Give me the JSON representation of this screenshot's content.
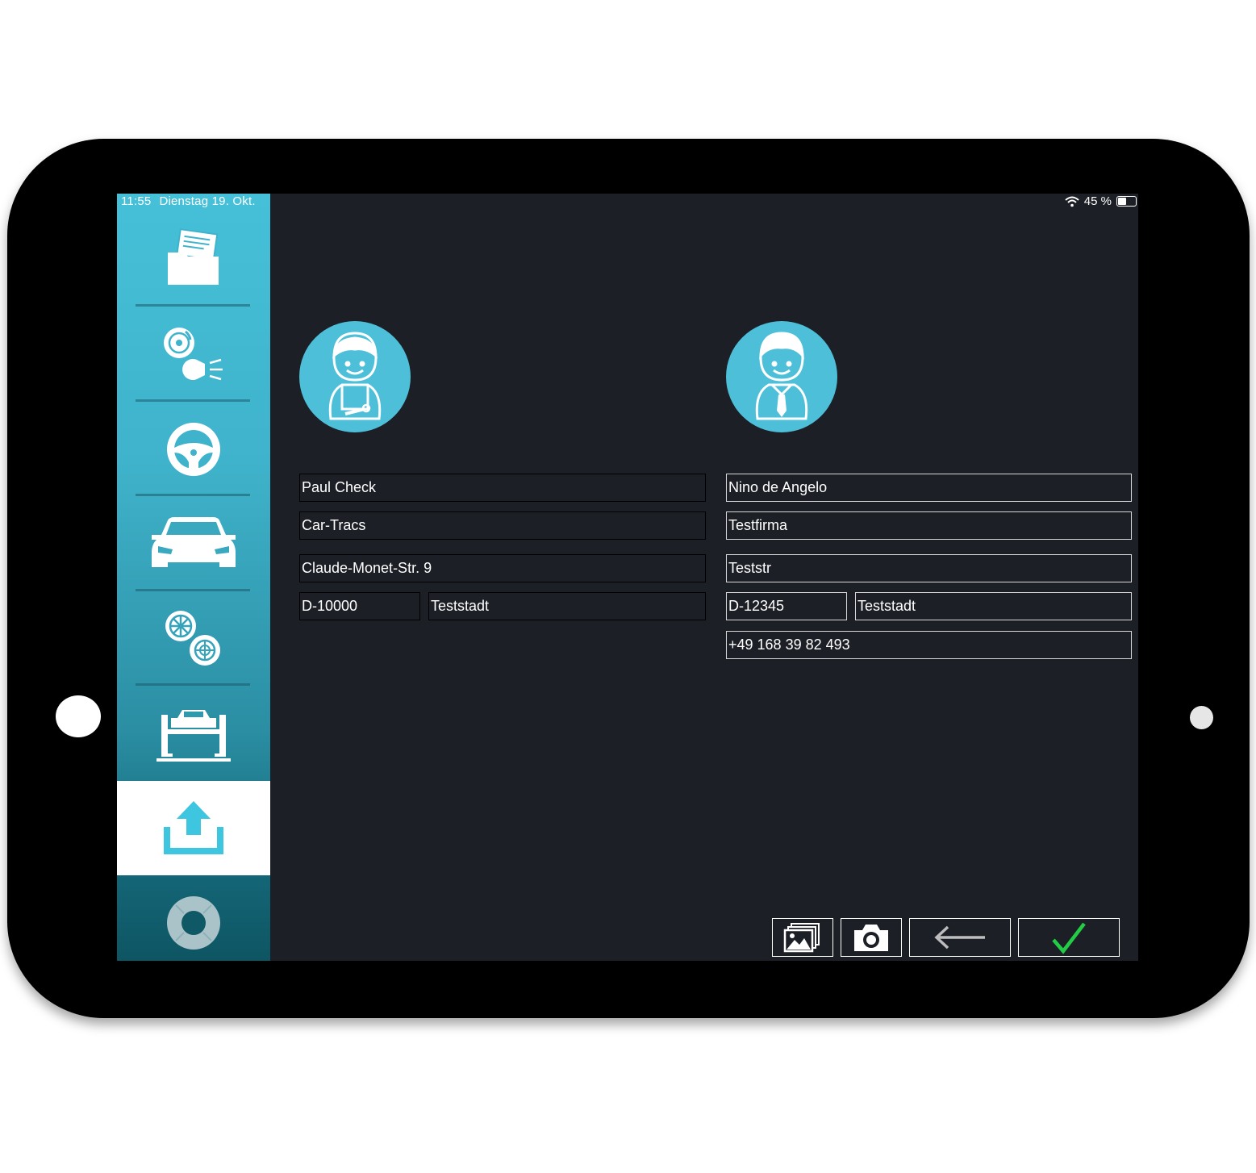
{
  "status_bar": {
    "time": "11:55",
    "date": "Dienstag 19. Okt.",
    "battery_percent": "45 %",
    "battery_level": 0.45,
    "wifi_icon": "wifi-icon"
  },
  "sidebar": {
    "items": [
      {
        "name": "documents",
        "icon": "folder-documents-icon"
      },
      {
        "name": "brakes-lights",
        "icon": "brake-light-icon"
      },
      {
        "name": "steering",
        "icon": "steering-wheel-icon"
      },
      {
        "name": "vehicle",
        "icon": "car-front-icon"
      },
      {
        "name": "wheels",
        "icon": "wheels-icon"
      },
      {
        "name": "lift",
        "icon": "car-lift-icon"
      },
      {
        "name": "upload",
        "icon": "upload-icon",
        "active": true
      },
      {
        "name": "lifebuoy",
        "icon": "lifebuoy-icon"
      }
    ]
  },
  "mechanic": {
    "avatar_icon": "mechanic-avatar-icon",
    "name": "Paul Check",
    "company": "Car-Tracs",
    "street": "Claude-Monet-Str. 9",
    "zip": "D-10000",
    "city": "Teststadt"
  },
  "customer": {
    "avatar_icon": "customer-avatar-icon",
    "name": "Nino de Angelo",
    "company": "Testfirma",
    "street": "Teststr",
    "zip": "D-12345",
    "city": "Teststadt",
    "phone": "+49 168 39 82 493"
  },
  "toolbar": {
    "gallery_icon": "gallery-icon",
    "camera_icon": "camera-icon",
    "back_icon": "arrow-left-icon",
    "confirm_icon": "checkmark-icon",
    "confirm_color": "#22cc44"
  },
  "colors": {
    "sidebar_top": "#45c0d8",
    "avatar_bg": "#4ebfd8",
    "screen_bg": "#1c1f26"
  }
}
